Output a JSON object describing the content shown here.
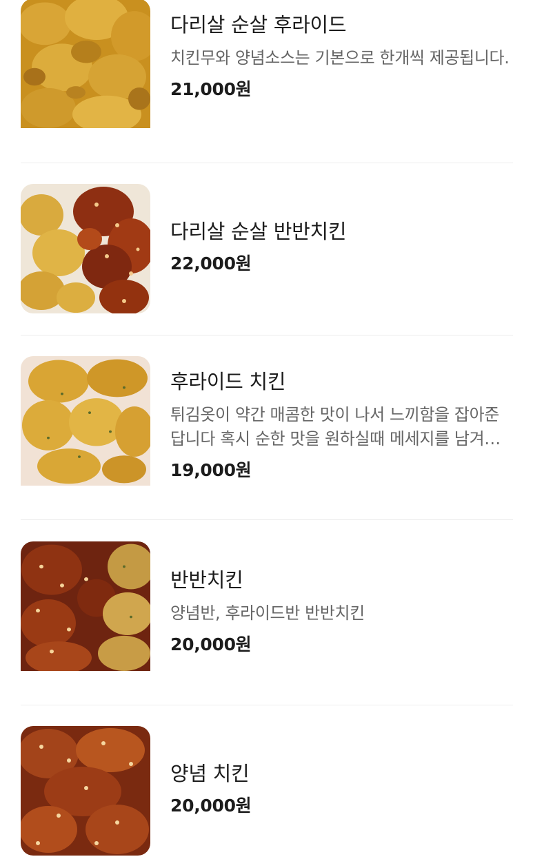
{
  "menu": {
    "items": [
      {
        "name": "다리살 순살 후라이드",
        "description": "치킨무와 양념소스는 기본으로 한개씩 제공됩니다.",
        "price": "21,000원",
        "image": "boneless-fried-chicken-photo"
      },
      {
        "name": "다리살 순살 반반치킨",
        "description": "",
        "price": "22,000원",
        "image": "boneless-half-half-chicken-photo"
      },
      {
        "name": "후라이드 치킨",
        "description": "튀김옷이 약간 매콤한 맛이 나서 느끼함을 잡아준답니다 혹시 순한 맛을 원하실때 메세지를 남겨주세요",
        "price": "19,000원",
        "image": "fried-chicken-photo"
      },
      {
        "name": "반반치킨",
        "description": "양념반, 후라이드반 반반치킨",
        "price": "20,000원",
        "image": "half-half-chicken-photo"
      },
      {
        "name": "양념 치킨",
        "description": "",
        "price": "20,000원",
        "image": "seasoned-chicken-photo"
      }
    ]
  }
}
